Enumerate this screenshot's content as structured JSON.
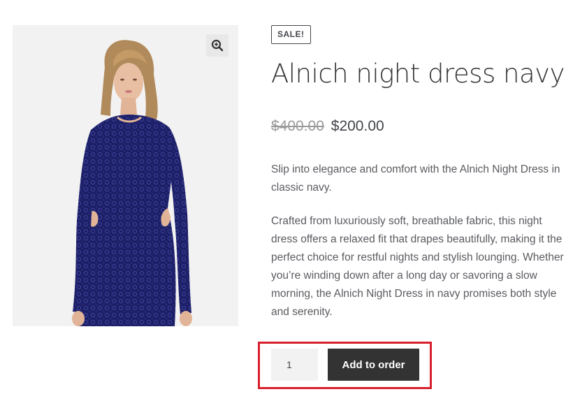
{
  "product": {
    "badge": "SALE!",
    "title": "Alnich night dress navy",
    "price_old": "$400.00",
    "price_new": "$200.00",
    "description": [
      "Slip into elegance and comfort with the Alnich Night Dress in classic navy.",
      "Crafted from luxuriously soft, breathable fabric, this night dress offers a relaxed fit that drapes beautifully, making it the perfect choice for restful nights and stylish lounging.  Whether you’re winding down after a long day or savoring a slow morning, the Alnich Night Dress in navy promises both style and serenity."
    ],
    "image_subject": "woman-in-navy-lace-dress",
    "zoom_icon": "zoom-in-icon"
  },
  "cart": {
    "quantity": "1",
    "add_label": "Add to order"
  },
  "colors": {
    "button_bg": "#333333",
    "highlight": "#d8202d",
    "dress": "#1c1f66"
  }
}
